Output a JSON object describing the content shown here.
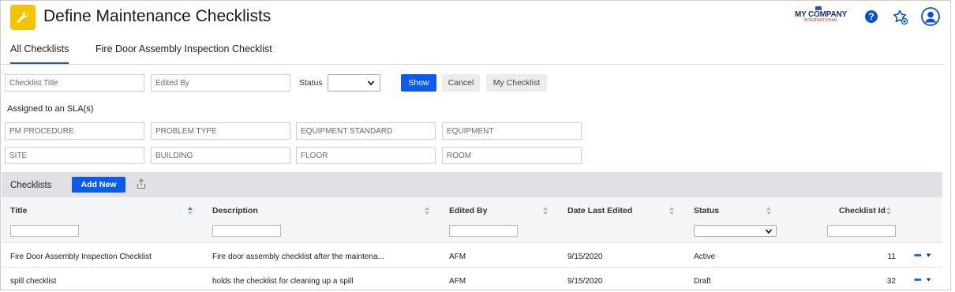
{
  "header": {
    "title": "Define Maintenance Checklists",
    "app_icon": "wrench-icon",
    "logo_main": "MY COMPANY",
    "logo_sub": "INTERNATIONAL",
    "icons": [
      "help-icon",
      "favorites-icon",
      "user-avatar-icon"
    ]
  },
  "tabs": [
    {
      "label": "All Checklists",
      "active": true
    },
    {
      "label": "Fire Door Assembly Inspection Checklist",
      "active": false
    }
  ],
  "filters": {
    "checklist_title_placeholder": "Checklist Title",
    "edited_by_placeholder": "Edited By",
    "status_label": "Status",
    "status_value": "",
    "show_label": "Show",
    "cancel_label": "Cancel",
    "my_checklist_label": "My Checklist"
  },
  "sla": {
    "label": "Assigned to an SLA(s)",
    "fields": [
      "PM PROCEDURE",
      "PROBLEM TYPE",
      "EQUIPMENT STANDARD",
      "EQUIPMENT",
      "SITE",
      "BUILDING",
      "FLOOR",
      "ROOM"
    ]
  },
  "panel": {
    "title": "Checklists",
    "add_label": "Add New",
    "export_icon": "export-icon"
  },
  "grid": {
    "columns": [
      "Title",
      "Description",
      "Edited By",
      "Date Last Edited",
      "Status",
      "Checklist Id"
    ],
    "rows": [
      {
        "title": "Fire Door Assembly Inspection Checklist",
        "description": "Fire door assembly checklist after the maintena...",
        "edited_by": "AFM",
        "date": "9/15/2020",
        "status": "Active",
        "id": "11"
      },
      {
        "title": "spill checklist",
        "description": "holds the checklist for cleaning up a spill",
        "edited_by": "AFM",
        "date": "9/15/2020",
        "status": "Draft",
        "id": "32"
      }
    ],
    "row_menu": "•••"
  },
  "colors": {
    "accent": "#0d5bea",
    "app_icon_bg": "#f5c400",
    "panel_bar": "#dfe1e5"
  }
}
